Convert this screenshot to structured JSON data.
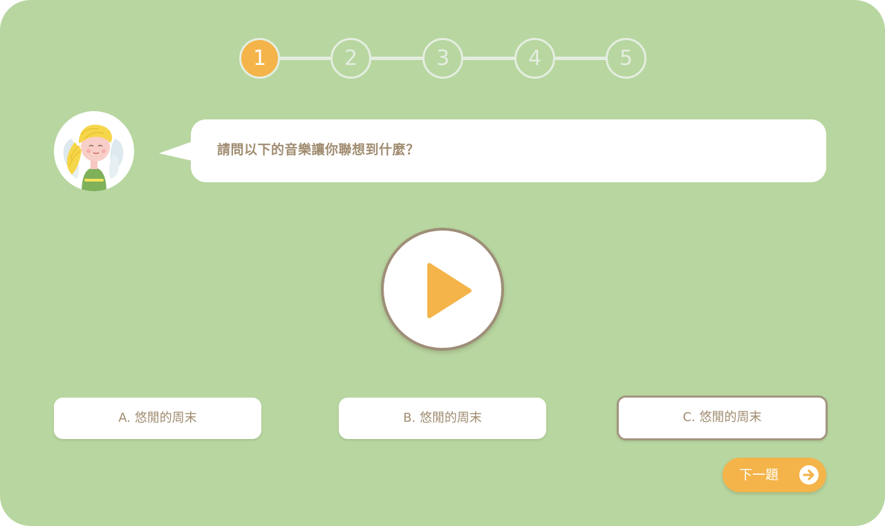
{
  "stepper": {
    "steps": [
      "1",
      "2",
      "3",
      "4",
      "5"
    ],
    "current": 1
  },
  "question": {
    "text": "請問以下的音樂讓你聯想到什麼？"
  },
  "play_button": {
    "icon": "play-icon"
  },
  "options": [
    {
      "label": "A. 悠閒的周末",
      "selected": false
    },
    {
      "label": "B. 悠閒的周末",
      "selected": false
    },
    {
      "label": "C. 悠閒的周末",
      "selected": true
    }
  ],
  "next_button": {
    "label": "下一題",
    "icon": "arrow-right-circle-icon"
  },
  "colors": {
    "background": "#b8d6a0",
    "accent": "#f4b44a",
    "text": "#a08c70",
    "border": "#9e8e78"
  }
}
